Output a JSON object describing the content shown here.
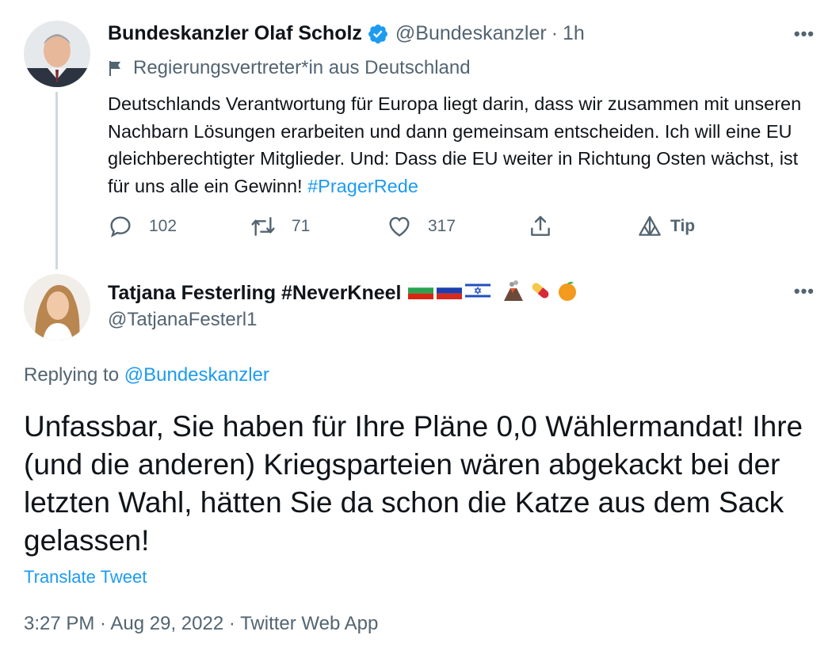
{
  "original": {
    "author_name": "Bundeskanzler Olaf Scholz",
    "handle": "@Bundeskanzler",
    "separator": "·",
    "time": "1h",
    "label": "Regierungsvertreter*in aus Deutschland",
    "text": "Deutschlands Verantwortung für Europa liegt darin, dass wir zusammen mit unseren Nachbarn Lösungen erarbeiten und dann gemeinsam entscheiden. Ich will eine EU gleichberechtigter Mitglieder. Und: Dass die EU weiter in Richtung Osten wächst, ist für uns alle ein Gewinn! ",
    "hashtag": "#PragerRede",
    "more": "•••",
    "actions": {
      "replies": "102",
      "retweets": "71",
      "likes": "317",
      "tip": "Tip"
    }
  },
  "reply": {
    "author_name": "Tatjana Festerling #NeverKneel",
    "handle": "@TatjanaFesterl1",
    "more": "•••",
    "replying_prefix": "Replying to ",
    "replying_to": "@Bundeskanzler",
    "text": "Unfassbar, Sie haben für Ihre Pläne 0,0 Wählermandat! Ihre (und die anderen) Kriegsparteien wären abgekackt bei der letzten Wahl, hätten Sie da schon die Katze aus dem Sack gelassen!",
    "translate": "Translate Tweet",
    "timestamp": "3:27 PM · Aug 29, 2022 · Twitter Web App"
  },
  "colors": {
    "accent": "#1d9bf0",
    "muted": "#536471",
    "text": "#0f1419",
    "thread_line": "#cfd9de"
  },
  "icons": [
    "verified-badge-icon",
    "government-flag-icon",
    "reply-icon",
    "retweet-icon",
    "like-icon",
    "share-icon",
    "tip-icon",
    "more-icon",
    "bulgaria-flag-icon",
    "russia-flag-icon",
    "israel-flag-icon",
    "volcano-icon",
    "pill-icon",
    "orange-icon"
  ]
}
